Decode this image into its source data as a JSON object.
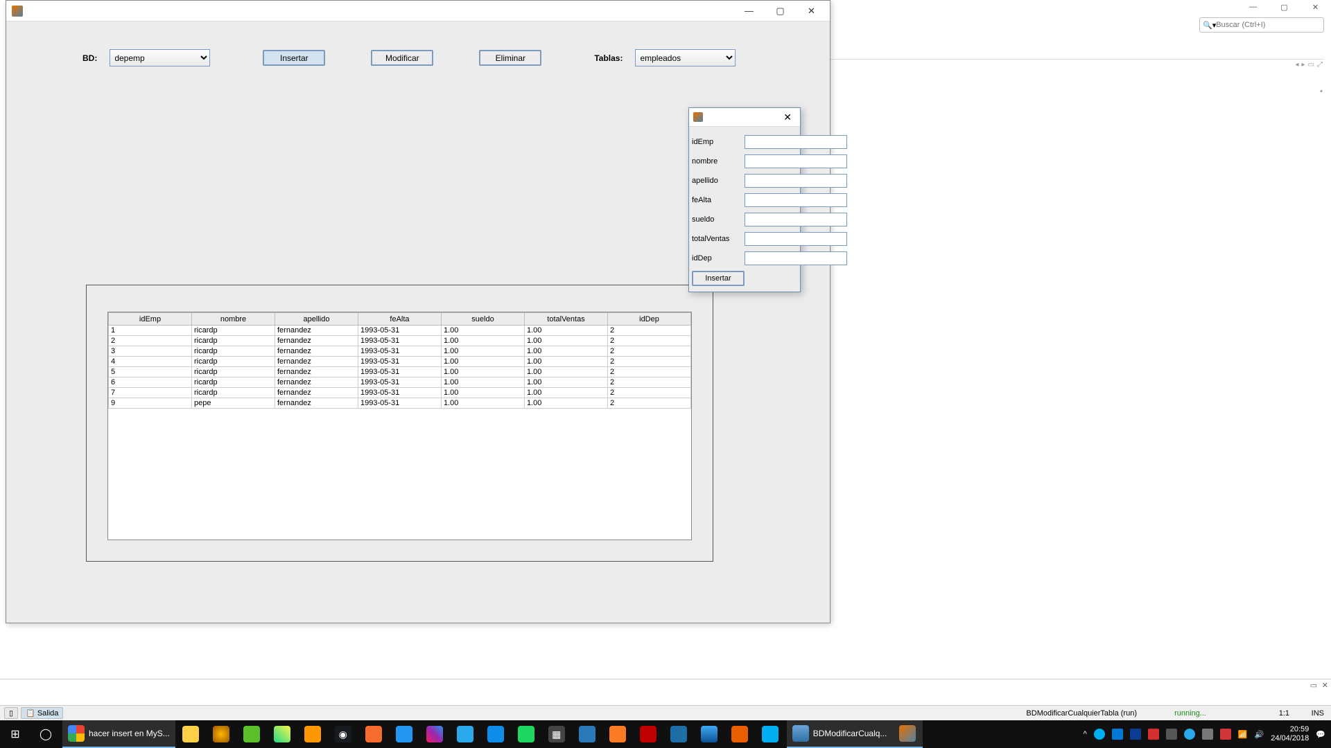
{
  "ide": {
    "search_placeholder": "Buscar (Ctrl+I)",
    "statusbar": {
      "salida": "Salida",
      "run_label": "BDModificarCualquierTabla (run)",
      "running": "running...",
      "pos": "1:1",
      "ins": "INS"
    }
  },
  "app": {
    "labels": {
      "bd": "BD:",
      "tablas": "Tablas:"
    },
    "selects": {
      "bd": "depemp",
      "tablas": "empleados"
    },
    "buttons": {
      "insertar": "Insertar",
      "modificar": "Modificar",
      "eliminar": "Eliminar"
    },
    "table": {
      "columns": [
        "idEmp",
        "nombre",
        "apellido",
        "feAlta",
        "sueldo",
        "totalVentas",
        "idDep"
      ],
      "rows": [
        [
          "1",
          "ricardp",
          "fernandez",
          "1993-05-31",
          "1.00",
          "1.00",
          "2"
        ],
        [
          "2",
          "ricardp",
          "fernandez",
          "1993-05-31",
          "1.00",
          "1.00",
          "2"
        ],
        [
          "3",
          "ricardp",
          "fernandez",
          "1993-05-31",
          "1.00",
          "1.00",
          "2"
        ],
        [
          "4",
          "ricardp",
          "fernandez",
          "1993-05-31",
          "1.00",
          "1.00",
          "2"
        ],
        [
          "5",
          "ricardp",
          "fernandez",
          "1993-05-31",
          "1.00",
          "1.00",
          "2"
        ],
        [
          "6",
          "ricardp",
          "fernandez",
          "1993-05-31",
          "1.00",
          "1.00",
          "2"
        ],
        [
          "7",
          "ricardp",
          "fernandez",
          "1993-05-31",
          "1.00",
          "1.00",
          "2"
        ],
        [
          "9",
          "pepe",
          "fernandez",
          "1993-05-31",
          "1.00",
          "1.00",
          "2"
        ]
      ]
    }
  },
  "dialog": {
    "fields": {
      "idEmp": "idEmp",
      "nombre": "nombre",
      "apellido": "apellido",
      "feAlta": "feAlta",
      "sueldo": "sueldo",
      "totalVentas": "totalVentas",
      "idDep": "idDep"
    },
    "button": "Insertar"
  },
  "taskbar": {
    "browser_tab": "hacer insert en MyS...",
    "app_tab": "BDModificarCualq...",
    "clock": {
      "time": "20:59",
      "date": "24/04/2018"
    }
  }
}
